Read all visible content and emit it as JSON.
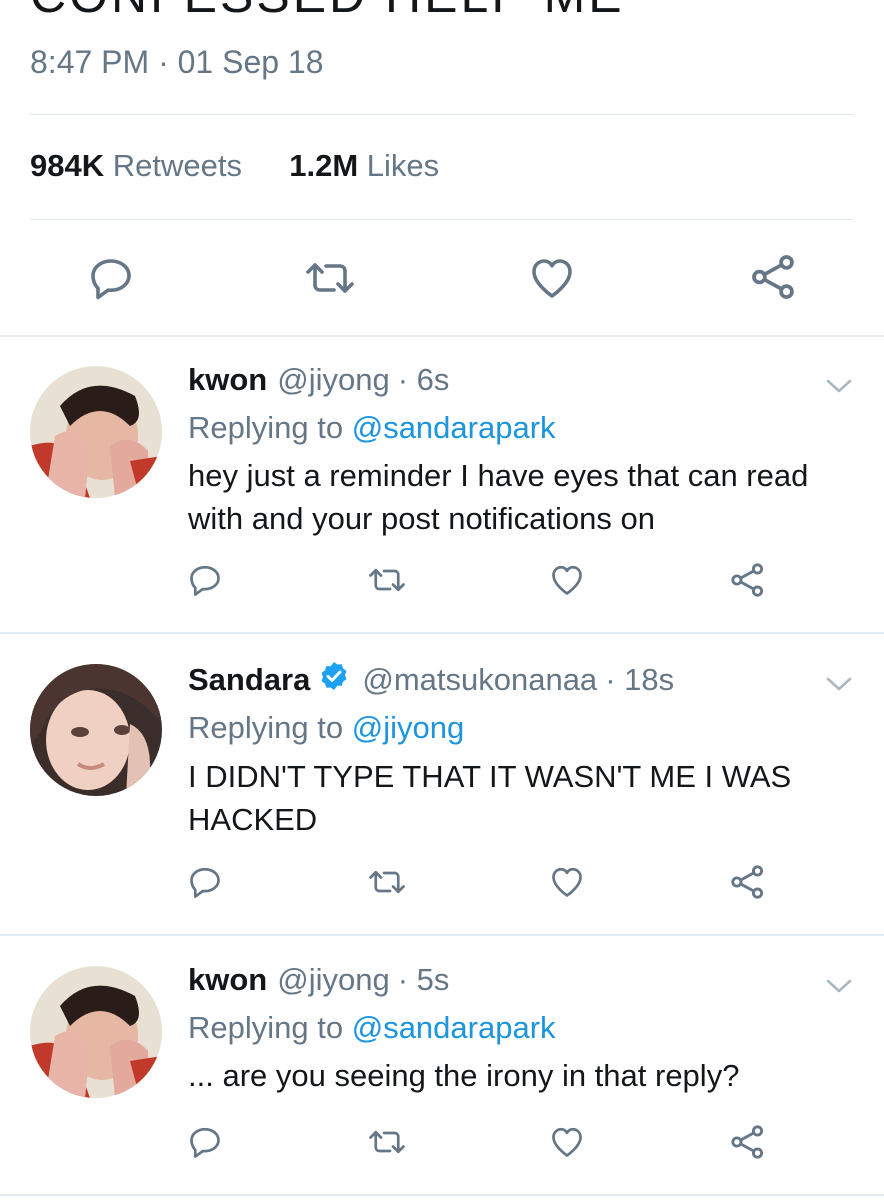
{
  "main_tweet": {
    "text_fragment": "CONFESSED HELP ME",
    "timestamp": "8:47 PM · 01 Sep 18",
    "retweets_count": "984K",
    "retweets_label": "Retweets",
    "likes_count": "1.2M",
    "likes_label": "Likes"
  },
  "replies": [
    {
      "name": "kwon",
      "handle": "@jiyong",
      "time": "· 6s",
      "verified": false,
      "replying_prefix": "Replying to",
      "replying_to": "@sandarapark",
      "text": "hey just a reminder I have eyes that can read with and your post notifications on"
    },
    {
      "name": "Sandara",
      "handle": "@matsukonanaa",
      "time": "· 18s",
      "verified": true,
      "replying_prefix": "Replying to",
      "replying_to": "@jiyong",
      "text": "I DIDN'T TYPE THAT IT WASN'T ME I WAS HACKED"
    },
    {
      "name": "kwon",
      "handle": "@jiyong",
      "time": "· 5s",
      "verified": false,
      "replying_prefix": "Replying to",
      "replying_to": "@sandarapark",
      "text": "... are you seeing the irony in that reply?"
    }
  ],
  "icons": {
    "reply": "comment-bubble-icon",
    "retweet": "retweet-icon",
    "like": "heart-icon",
    "share": "share-icon",
    "more": "chevron-down-icon",
    "verified": "verified-badge-icon"
  },
  "colors": {
    "text": "#14171a",
    "secondary": "#657786",
    "link": "#1b95e0",
    "verified": "#1da1f2",
    "divider": "#e1e8ed"
  }
}
